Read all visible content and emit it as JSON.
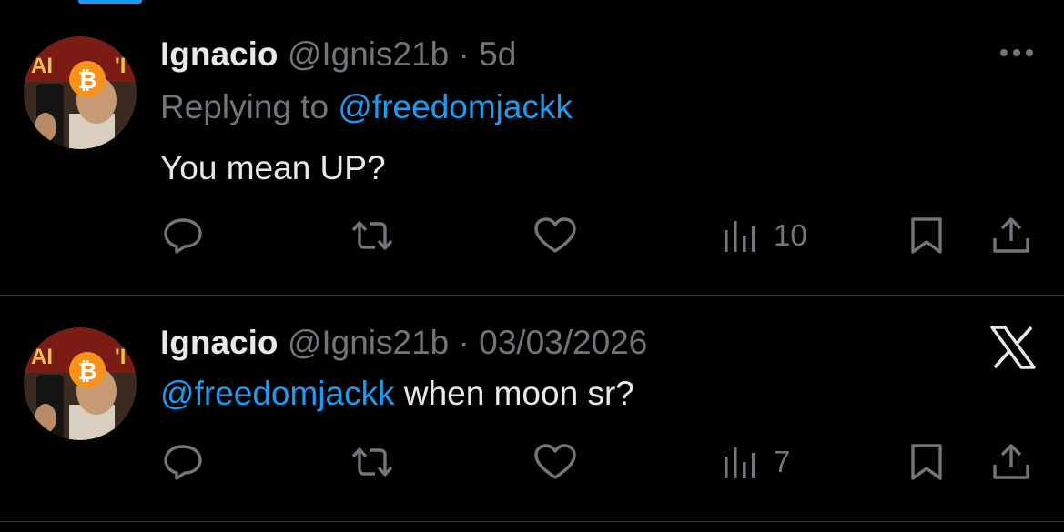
{
  "colors": {
    "background": "#000000",
    "text": "#e7e9ea",
    "muted": "#71767b",
    "link": "#1d9bf0",
    "divider": "#2f3336"
  },
  "tweets": [
    {
      "name": "Ignacio",
      "handle": "@Ignis21b",
      "separator": "·",
      "time": "5d",
      "replying_prefix": "Replying to",
      "replying_handle": "@freedomjackk",
      "body": "You mean UP?",
      "corner_icon": "more-icon",
      "views": "10"
    },
    {
      "name": "Ignacio",
      "handle": "@Ignis21b",
      "separator": "·",
      "time": "03/03/2026",
      "mention": "@freedomjackk",
      "body": "when moon sr?",
      "corner_icon": "x-logo-icon",
      "views": "7"
    }
  ]
}
